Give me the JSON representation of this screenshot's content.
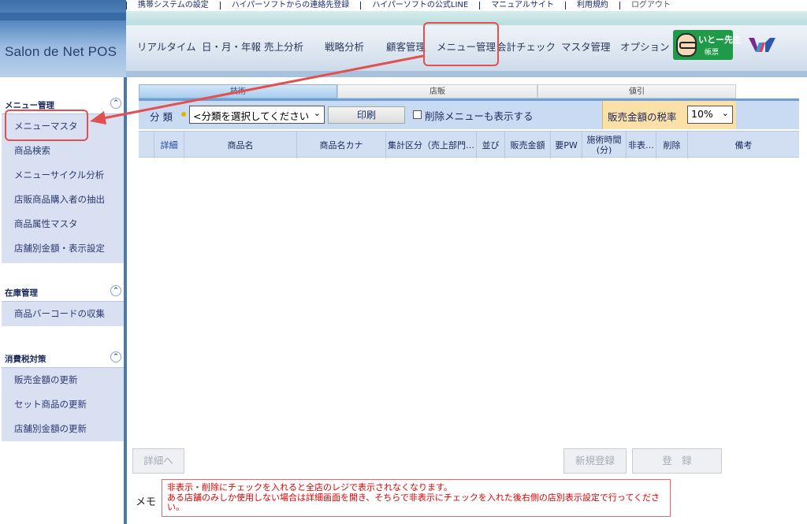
{
  "top_links": [
    "携帯システムの設定",
    "ハイパーソフトからの連絡先登録",
    "ハイパーソフトの公式LINE",
    "マニュアルサイト",
    "利用規約",
    "ログアウト"
  ],
  "app": {
    "logo_text": "Salon de Net POS"
  },
  "nav": {
    "items": [
      "リアルタイム",
      "日・月・年報",
      "売上分析",
      "戦略分析",
      "顧客管理",
      "メニュー管理",
      "会計チェック",
      "マスタ管理",
      "オプション"
    ],
    "selected": "メニュー管理"
  },
  "user_badge": {
    "name": "いとー先生",
    "role": "帳票"
  },
  "sidebar": {
    "sections": [
      {
        "title": "メニュー管理",
        "toggle": "⌃",
        "items": [
          "メニューマスタ",
          "商品検索",
          "メニューサイクル分析",
          "店販商品購入者の抽出",
          "商品属性マスタ",
          "店舗別金額・表示設定"
        ]
      },
      {
        "title": "在庫管理",
        "toggle": "⌃",
        "items": [
          "商品バーコードの収集"
        ]
      },
      {
        "title": "消費税対策",
        "toggle": "⌃",
        "items": [
          "販売金額の更新",
          "セット商品の更新",
          "店舗別金額の更新"
        ]
      }
    ],
    "selected_item": "メニューマスタ"
  },
  "tabs": [
    {
      "label": "技術",
      "active": true
    },
    {
      "label": "店販",
      "active": false
    },
    {
      "label": "値引",
      "active": false
    }
  ],
  "filter": {
    "category_label": "分 類",
    "category_value": "<分類を選択してください",
    "print_label": "印刷",
    "show_deleted_label": "削除メニューも表示する",
    "show_deleted_checked": false,
    "tax_label": "販売金額の税率",
    "tax_value": "10%"
  },
  "table": {
    "headers": [
      "",
      "詳細",
      "商品名",
      "商品名カナ",
      "集計区分（売上部門…",
      "並び",
      "販売金額",
      "要PW",
      "施術時間\n(分)",
      "非表…",
      "削除",
      "備考"
    ],
    "rows": []
  },
  "actions": {
    "detail": "詳細へ",
    "new": "新規登録",
    "register": "登　録"
  },
  "memo": {
    "label": "メモ",
    "lines": [
      "非表示・削除にチェックを入れると全店のレジで表示されなくなります。",
      "ある店舗のみしか使用しない場合は詳細画面を開き、そちらで非表示にチェックを入れた後右側の店別表示設定で行ってください。"
    ]
  },
  "colors": {
    "accent_blue": "#4a78b0",
    "callout_red": "#e2504f",
    "memo_red": "#e00000",
    "tax_bg": "#fbe0a8"
  }
}
